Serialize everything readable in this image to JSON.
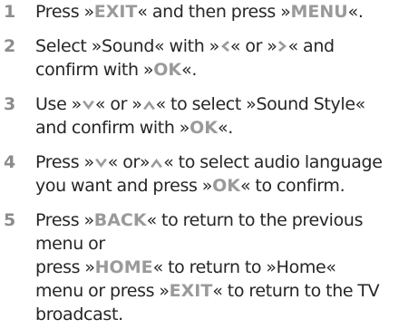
{
  "steps": [
    {
      "number": "1",
      "parts": {
        "a": "Press »",
        "exit": "EXIT",
        "b": "« and then press »",
        "menu": "MENU",
        "c": "«."
      }
    },
    {
      "number": "2",
      "parts": {
        "a": "Select »Sound« with »",
        "b": "« or »",
        "c": "« and",
        "d": "confirm with »",
        "ok": "OK",
        "e": "«."
      },
      "icons": [
        "arrow-left-icon",
        "arrow-right-icon"
      ]
    },
    {
      "number": "3",
      "parts": {
        "a": "Use »",
        "b": "« or »",
        "c": "« to select »Sound Style«",
        "d": "and confirm with »",
        "ok": "OK",
        "e": "«."
      },
      "icons": [
        "arrow-down-icon",
        "arrow-up-icon"
      ]
    },
    {
      "number": "4",
      "parts": {
        "a": "Press »",
        "b": "« or»",
        "c": "« to select audio language",
        "d": "you want and press »",
        "ok": "OK",
        "e": "« to confirm."
      },
      "icons": [
        "arrow-down-icon",
        "arrow-up-icon"
      ]
    },
    {
      "number": "5",
      "parts": {
        "a": "Press »",
        "back": "BACK",
        "b": "« to return to the previous",
        "c": "menu or",
        "d": "press »",
        "home": "HOME",
        "e": "« to return to »Home«",
        "f": "menu or press »",
        "exit": "EXIT",
        "g": "« to return to the TV",
        "h": "broadcast."
      }
    }
  ],
  "colors": {
    "text": "#262626",
    "key_label": "#9a9a9a",
    "step_number": "#8c8c8c"
  }
}
